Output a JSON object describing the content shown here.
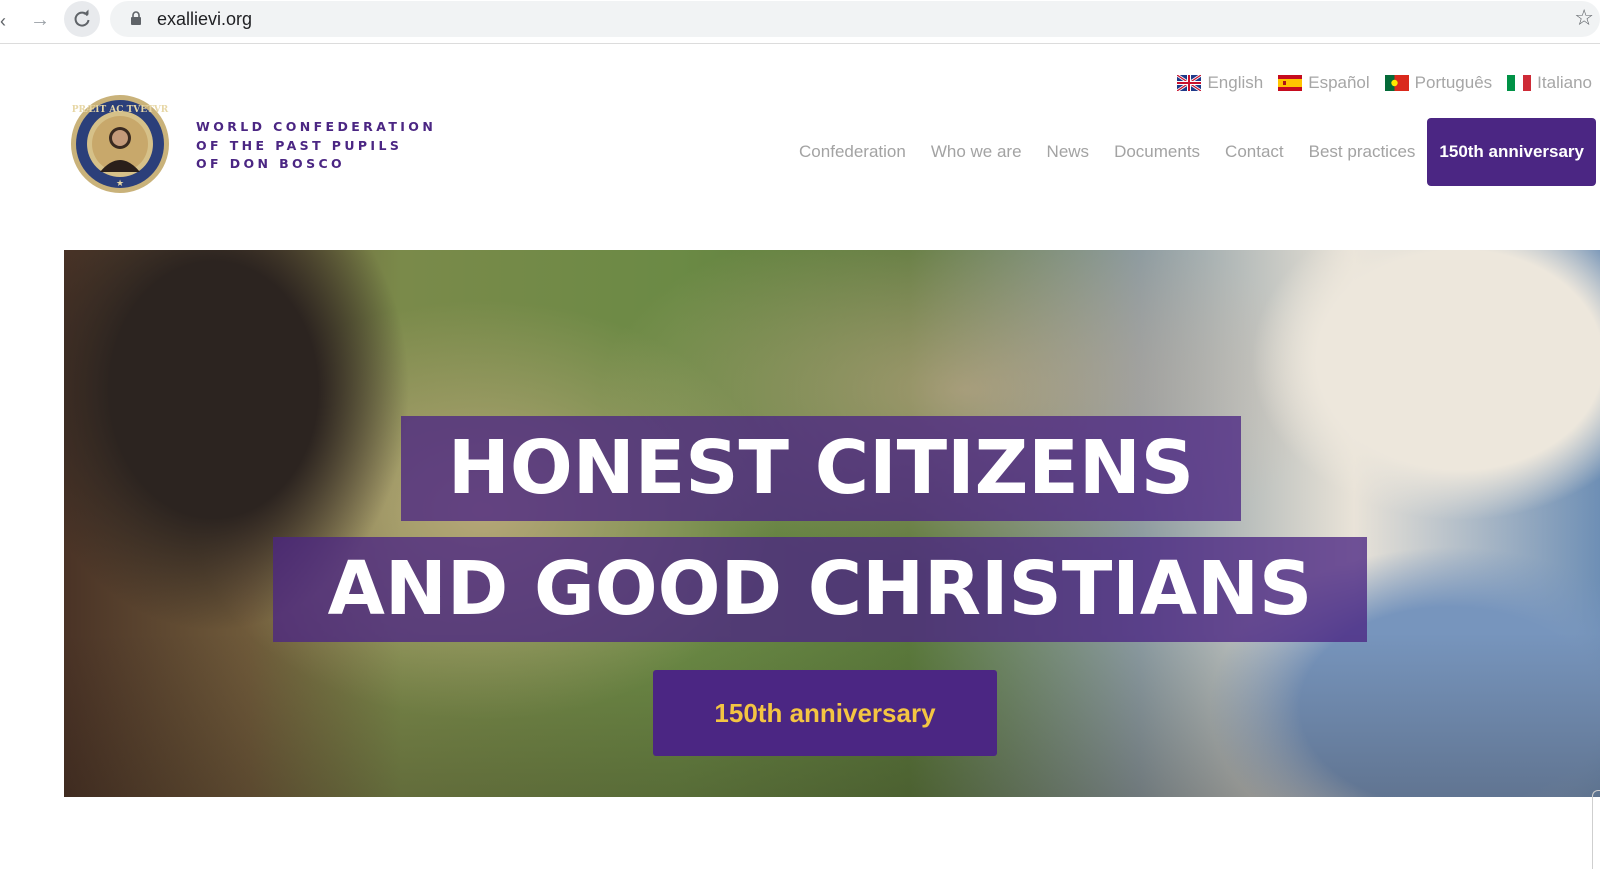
{
  "browser": {
    "url": "exallievi.org"
  },
  "header": {
    "logo_motto": "PRÆIT AC TVETVR",
    "brand_lines": [
      "WORLD CONFEDERATION",
      "OF THE PAST PUPILS",
      "OF DON BOSCO"
    ]
  },
  "languages": [
    {
      "label": "English",
      "flag": "uk-flag-icon"
    },
    {
      "label": "Español",
      "flag": "spain-flag-icon"
    },
    {
      "label": "Português",
      "flag": "portugal-flag-icon"
    },
    {
      "label": "Italiano",
      "flag": "italy-flag-icon"
    }
  ],
  "nav": {
    "items": [
      "Confederation",
      "Who we are",
      "News",
      "Documents",
      "Contact",
      "Best practices"
    ],
    "cta": "150th anniversary"
  },
  "hero": {
    "headline_1": "HONEST CITIZENS",
    "headline_2": "AND GOOD CHRISTIANS",
    "button": "150th anniversary"
  },
  "colors": {
    "brand_purple": "#4b2683",
    "cta_text_gold": "#f4c542",
    "nav_text": "#a3a3a3"
  }
}
